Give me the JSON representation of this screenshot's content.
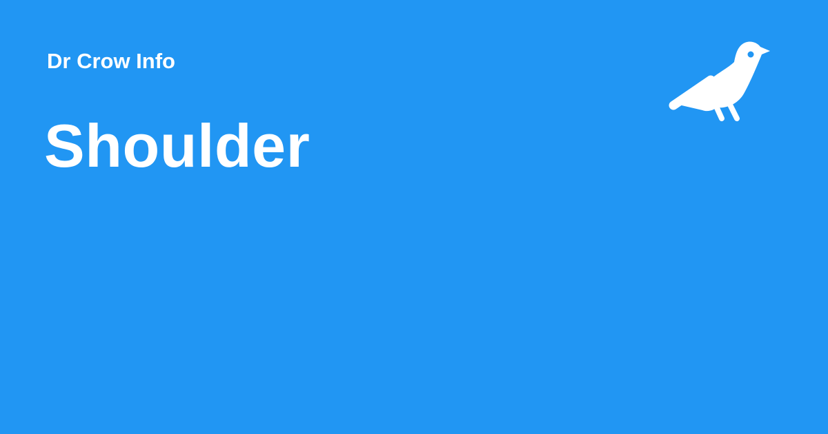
{
  "brand": {
    "name": "Dr Crow Info",
    "logo_icon": "crow-icon"
  },
  "page": {
    "title": "Shoulder"
  },
  "colors": {
    "background": "#2196f3",
    "foreground": "#ffffff"
  }
}
